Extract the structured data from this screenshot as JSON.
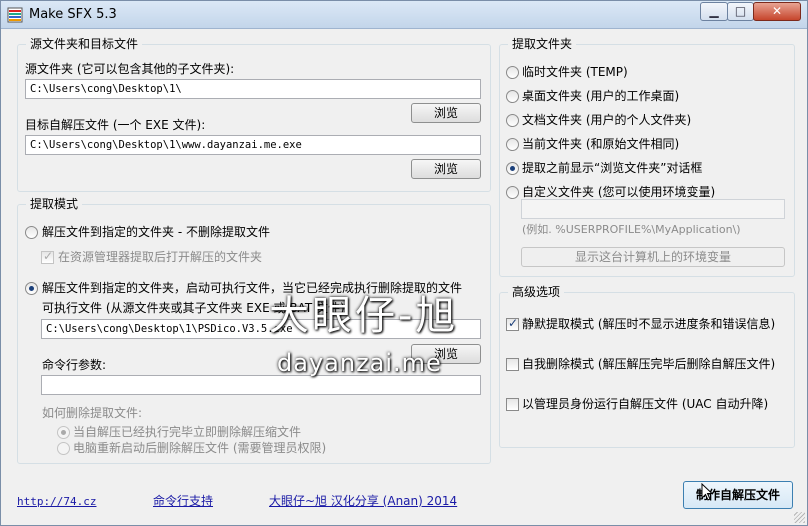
{
  "window": {
    "title": "Make SFX 5.3"
  },
  "source_group": {
    "legend": "源文件夹和目标文件",
    "source_label": "源文件夹 (它可以包含其他的子文件夹):",
    "source_value": "C:\\Users\\cong\\Desktop\\1\\",
    "browse1": "浏览",
    "target_label": "目标自解压文件 (一个 EXE 文件):",
    "target_value": "C:\\Users\\cong\\Desktop\\1\\www.dayanzai.me.exe",
    "browse2": "浏览"
  },
  "mode_group": {
    "legend": "提取模式",
    "opt1": "解压文件到指定的文件夹 - 不删除提取文件",
    "opt1_sub": "在资源管理器提取后打开解压的文件夹",
    "opt2": "解压文件到指定的文件夹，启动可执行文件，当它已经完成执行删除提取的文件",
    "exe_label": "可执行文件 (从源文件夹或其子文件夹 EXE 或 BAT 文件):",
    "exe_value": "C:\\Users\\cong\\Desktop\\1\\PSDico.V3.5.exe",
    "browse3": "浏览",
    "cmd_label": "命令行参数:",
    "cmd_value": "",
    "delete_label": "如何删除提取文件:",
    "del_opt1": "当自解压已经执行完毕立即删除解压缩文件",
    "del_opt2": "电脑重新启动后删除解压文件 (需要管理员权限)"
  },
  "extract_group": {
    "legend": "提取文件夹",
    "items": [
      "临时文件夹 (TEMP)",
      "桌面文件夹 (用户的工作桌面)",
      "文档文件夹 (用户的个人文件夹)",
      "当前文件夹 (和原始文件相同)",
      "提取之前显示“浏览文件夹”对话框",
      "自定义文件夹 (您可以使用环境变量)"
    ],
    "selected_index": 4,
    "custom_value": "",
    "example": "(例如. %USERPROFILE%\\MyApplication\\)",
    "env_button": "显示这台计算机上的环境变量"
  },
  "advanced_group": {
    "legend": "高级选项",
    "silent": "静默提取模式 (解压时不显示进度条和错误信息)",
    "silent_checked": true,
    "selfdelete": "自我删除模式 (解压解压完毕后删除自解压文件)",
    "selfdelete_checked": false,
    "admin": "以管理员身份运行自解压文件 (UAC 自动升降)",
    "admin_checked": false
  },
  "footer": {
    "link1": "http://74.cz",
    "link2": "命令行支持",
    "link3": "大眼仔~旭 汉化分享 (Anan) 2014",
    "make_button": "制作自解压文件"
  },
  "watermark": {
    "main": "大眼仔-旭",
    "sub": "dayanzai.me"
  },
  "icons": [
    "app-icon",
    "minimize-icon",
    "maximize-icon",
    "close-icon",
    "resize-grip-icon",
    "cursor-icon"
  ]
}
